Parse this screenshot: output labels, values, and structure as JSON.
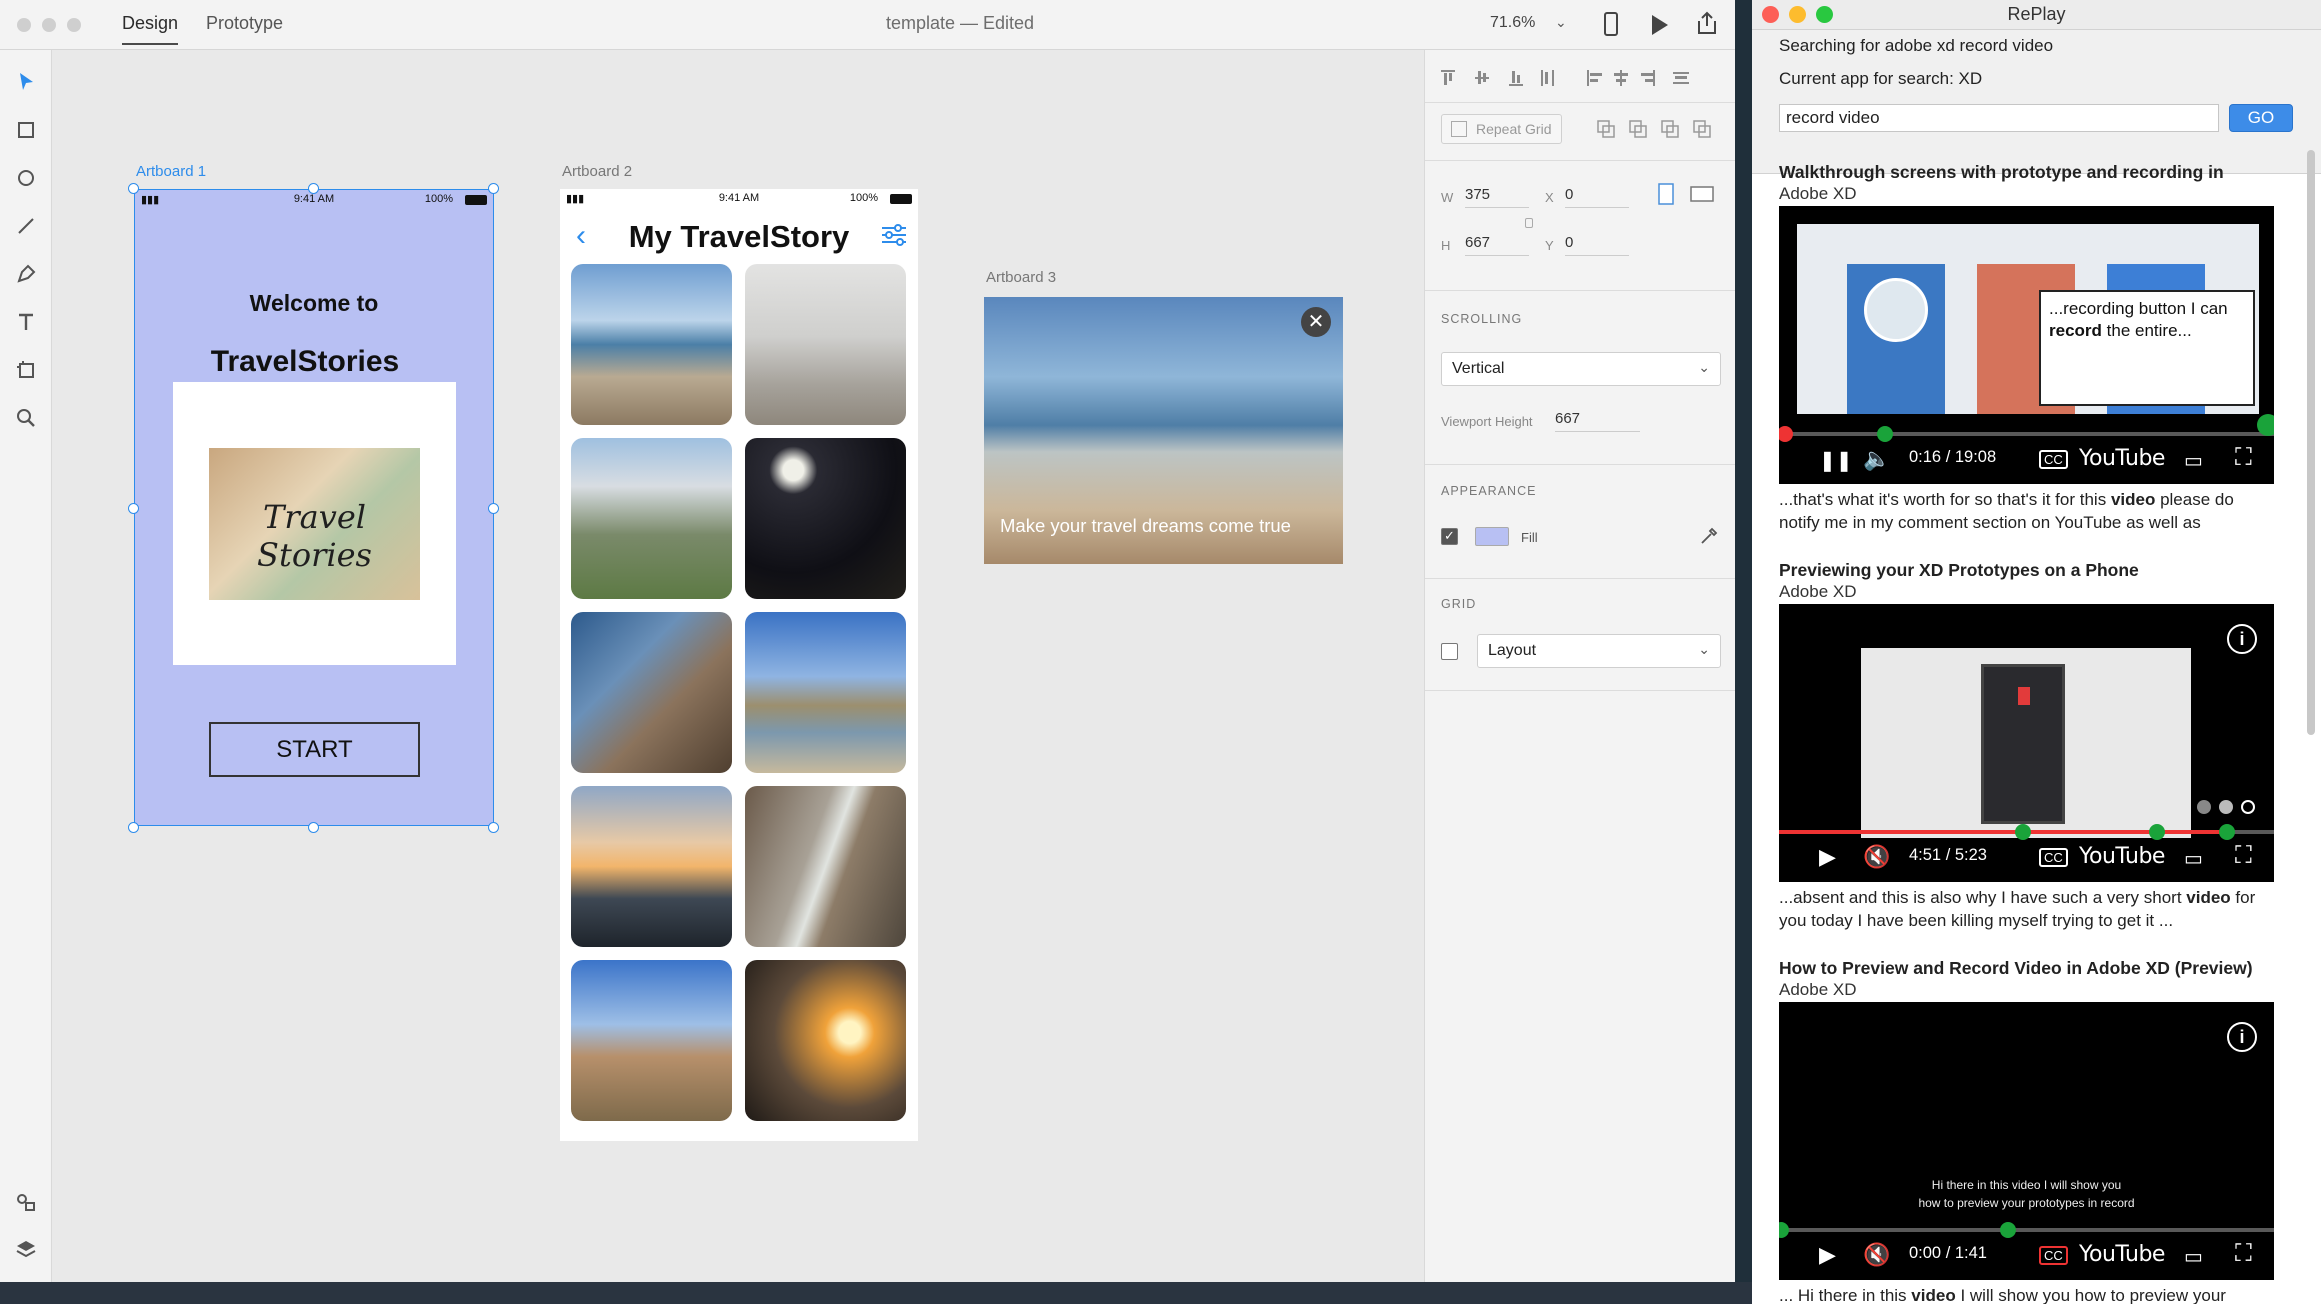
{
  "xd": {
    "tabs": [
      "Design",
      "Prototype"
    ],
    "doc_title": "template — Edited",
    "zoom": "71.6%",
    "artboards": {
      "ab1": {
        "label": "Artboard 1",
        "status_time": "9:41 AM",
        "status_battery": "100%",
        "welcome": "Welcome to",
        "brand": "TravelStories",
        "card_text": "Travel Stories",
        "start": "START"
      },
      "ab2": {
        "label": "Artboard 2",
        "status_time": "9:41 AM",
        "status_battery": "100%",
        "title": "My TravelStory"
      },
      "ab3": {
        "label": "Artboard 3",
        "caption": "Make your travel dreams come true"
      }
    },
    "props": {
      "repeat_grid": "Repeat Grid",
      "w_label": "W",
      "w_value": "375",
      "h_label": "H",
      "h_value": "667",
      "x_label": "X",
      "x_value": "0",
      "y_label": "Y",
      "y_value": "0",
      "scrolling_title": "SCROLLING",
      "scrolling_value": "Vertical",
      "viewport_label": "Viewport Height",
      "viewport_value": "667",
      "appearance_title": "APPEARANCE",
      "fill_label": "Fill",
      "fill_color": "#b8c0f3",
      "grid_title": "GRID",
      "grid_value": "Layout"
    }
  },
  "replay": {
    "title": "RePlay",
    "searching": "Searching for adobe xd record video",
    "current_app": "Current app for search: XD",
    "query": "record video",
    "go": "GO",
    "results": [
      {
        "title": "Walkthrough screens with prototype and recording in",
        "app": "Adobe XD",
        "time": "0:16 / 19:08",
        "tooltip_pre": "...recording button I can",
        "tooltip_bold": "record",
        "tooltip_post": "the entire...",
        "snippet_pre": "...that's what it's worth for so that's it for this",
        "snippet_bold": "video",
        "snippet_post": "please do notify me in my comment section on YouTube as well as"
      },
      {
        "title": "Previewing your XD Prototypes on a Phone",
        "app": "Adobe XD",
        "time": "4:51 / 5:23",
        "snippet_pre": "...absent and this is also why I have such a very short",
        "snippet_bold": "video",
        "snippet_post": "for you today I have been killing myself trying to get it ..."
      },
      {
        "title": "How to Preview and Record Video in Adobe XD (Preview)",
        "app": "Adobe XD",
        "time": "0:00 / 1:41",
        "subtitle_1": "Hi there in this video I will show you",
        "subtitle_2": "how to preview your prototypes in record",
        "snippet_pre": "... Hi there in this",
        "snippet_bold": "video",
        "snippet_post": "I will show you how to preview your"
      }
    ],
    "youtube": "YouTube"
  }
}
